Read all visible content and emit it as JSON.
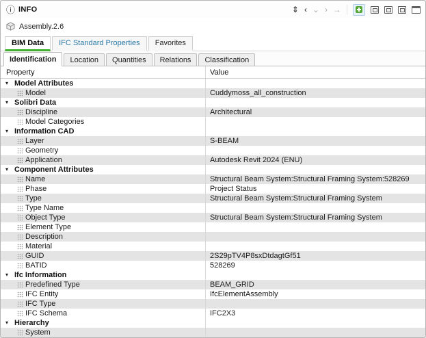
{
  "panel": {
    "title": "INFO",
    "selection": "Assembly.2.6"
  },
  "icons": {
    "info": "ⓘ",
    "assembly": "3d-cube",
    "navigate": "⇕",
    "back": "‹",
    "collapse": "⌄",
    "forward": "›",
    "jump": "→",
    "green_tool": "green-square-plus",
    "float_window": "window-with-inset",
    "duplicate_window": "window-with-inset",
    "pin_window": "window-with-inset",
    "maximize_window": "window-frame",
    "group_collapse": "▾",
    "property_item": "dot-grid"
  },
  "main_tabs": [
    {
      "label": "BIM Data",
      "active": true
    },
    {
      "label": "IFC Standard Properties",
      "active": false
    },
    {
      "label": "Favorites",
      "active": false
    }
  ],
  "sub_tabs": [
    {
      "label": "Identification",
      "active": true
    },
    {
      "label": "Location",
      "active": false
    },
    {
      "label": "Quantities",
      "active": false
    },
    {
      "label": "Relations",
      "active": false
    },
    {
      "label": "Classification",
      "active": false
    }
  ],
  "table": {
    "columns": [
      "Property",
      "Value"
    ],
    "rows": [
      {
        "type": "group",
        "label": "Model Attributes",
        "value": "",
        "shaded": false
      },
      {
        "type": "item",
        "label": "Model",
        "value": "Cuddymoss_all_construction",
        "shaded": true
      },
      {
        "type": "group",
        "label": "Solibri Data",
        "value": "",
        "shaded": false
      },
      {
        "type": "item",
        "label": "Discipline",
        "value": "Architectural",
        "shaded": true
      },
      {
        "type": "item",
        "label": "Model Categories",
        "value": "",
        "shaded": false
      },
      {
        "type": "group",
        "label": "Information CAD",
        "value": "",
        "shaded": false
      },
      {
        "type": "item",
        "label": "Layer",
        "value": "S-BEAM",
        "shaded": true
      },
      {
        "type": "item",
        "label": "Geometry",
        "value": "",
        "shaded": false
      },
      {
        "type": "item",
        "label": "Application",
        "value": "Autodesk Revit 2024 (ENU)",
        "shaded": true
      },
      {
        "type": "group",
        "label": "Component Attributes",
        "value": "",
        "shaded": false
      },
      {
        "type": "item",
        "label": "Name",
        "value": "Structural Beam System:Structural Framing System:528269",
        "shaded": true
      },
      {
        "type": "item",
        "label": "Phase",
        "value": "Project Status",
        "shaded": false
      },
      {
        "type": "item",
        "label": "Type",
        "value": "Structural Beam System:Structural Framing System",
        "shaded": true
      },
      {
        "type": "item",
        "label": "Type Name",
        "value": "",
        "shaded": false
      },
      {
        "type": "item",
        "label": "Object Type",
        "value": "Structural Beam System:Structural Framing System",
        "shaded": true
      },
      {
        "type": "item",
        "label": "Element Type",
        "value": "",
        "shaded": false
      },
      {
        "type": "item",
        "label": "Description",
        "value": "",
        "shaded": true
      },
      {
        "type": "item",
        "label": "Material",
        "value": "",
        "shaded": false
      },
      {
        "type": "item",
        "label": "GUID",
        "value": "2S29pTV4P8sxDtdagtGf51",
        "shaded": true
      },
      {
        "type": "item",
        "label": "BATID",
        "value": "528269",
        "shaded": false
      },
      {
        "type": "group",
        "label": "Ifc Information",
        "value": "",
        "shaded": false
      },
      {
        "type": "item",
        "label": "Predefined Type",
        "value": "BEAM_GRID",
        "shaded": true
      },
      {
        "type": "item",
        "label": "IFC Entity",
        "value": "IfcElementAssembly",
        "shaded": false
      },
      {
        "type": "item",
        "label": "IFC Type",
        "value": "",
        "shaded": true
      },
      {
        "type": "item",
        "label": "IFC Schema",
        "value": "IFC2X3",
        "shaded": false
      },
      {
        "type": "group",
        "label": "Hierarchy",
        "value": "",
        "shaded": false
      },
      {
        "type": "item",
        "label": "System",
        "value": "",
        "shaded": true
      }
    ]
  },
  "colors": {
    "accent_green": "#3fae2a",
    "link_blue": "#2878a8",
    "shaded_row": "#e4e4e4",
    "green_icon": "#57a639"
  }
}
